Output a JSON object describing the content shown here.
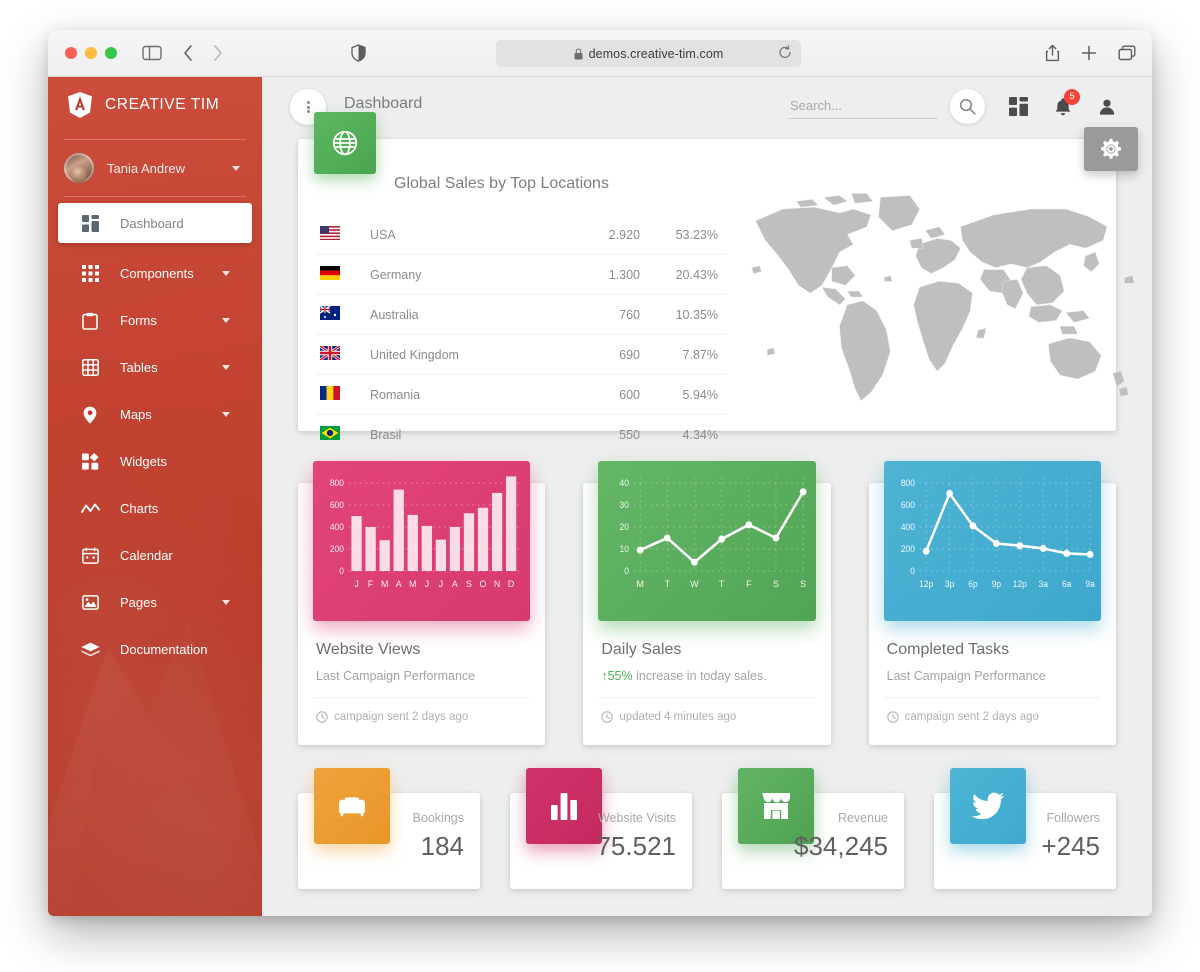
{
  "browser": {
    "url": "demos.creative-tim.com",
    "lock_icon": "lock-icon",
    "reload_icon": "reload-icon",
    "share_icon": "share-icon",
    "new_tab_icon": "plus-icon",
    "tabs_icon": "tabs-overview-icon",
    "shield_icon": "privacy-shield-icon",
    "sidebar_icon": "sidebar-toggle-icon",
    "back_icon": "chevron-left-icon",
    "forward_icon": "chevron-right-icon"
  },
  "sidebar": {
    "brand": "CREATIVE TIM",
    "brand_logo": "angular-shield-logo",
    "user": {
      "name": "Tania Andrew",
      "avatar": "user-avatar",
      "caret": "chevron-down-icon"
    },
    "items": [
      {
        "label": "Dashboard",
        "icon": "dashboard-grid-icon",
        "active": true,
        "expandable": false
      },
      {
        "label": "Components",
        "icon": "apps-grid-icon",
        "active": false,
        "expandable": true
      },
      {
        "label": "Forms",
        "icon": "clipboard-icon",
        "active": false,
        "expandable": true
      },
      {
        "label": "Tables",
        "icon": "table-grid-icon",
        "active": false,
        "expandable": true
      },
      {
        "label": "Maps",
        "icon": "map-pin-icon",
        "active": false,
        "expandable": true
      },
      {
        "label": "Widgets",
        "icon": "widgets-icon",
        "active": false,
        "expandable": false
      },
      {
        "label": "Charts",
        "icon": "line-chart-icon",
        "active": false,
        "expandable": false
      },
      {
        "label": "Calendar",
        "icon": "calendar-icon",
        "active": false,
        "expandable": false
      },
      {
        "label": "Pages",
        "icon": "image-icon",
        "active": false,
        "expandable": true
      },
      {
        "label": "Documentation",
        "icon": "book-stack-icon",
        "active": false,
        "expandable": false
      }
    ]
  },
  "header": {
    "title": "Dashboard",
    "menu_icon": "kebab-menu-icon",
    "search": {
      "placeholder": "Search...",
      "value": "",
      "icon": "search-icon"
    },
    "grid_icon": "dashboard-grid-icon",
    "notifications": {
      "icon": "bell-icon",
      "count": "5"
    },
    "account_icon": "person-icon"
  },
  "global_sales": {
    "title": "Global Sales by Top Locations",
    "badge_icon": "globe-icon",
    "settings_icon": "gear-icon",
    "rows": [
      {
        "flag": "flag-usa",
        "country": "USA",
        "value": "2.920",
        "percent": "53.23%"
      },
      {
        "flag": "flag-germany",
        "country": "Germany",
        "value": "1.300",
        "percent": "20.43%"
      },
      {
        "flag": "flag-australia",
        "country": "Australia",
        "value": "760",
        "percent": "10.35%"
      },
      {
        "flag": "flag-uk",
        "country": "United Kingdom",
        "value": "690",
        "percent": "7.87%"
      },
      {
        "flag": "flag-romania",
        "country": "Romania",
        "value": "600",
        "percent": "5.94%"
      },
      {
        "flag": "flag-brasil",
        "country": "Brasil",
        "value": "550",
        "percent": "4.34%"
      }
    ]
  },
  "chart_data": [
    {
      "type": "bar",
      "card_title": "Website Views",
      "card_subtitle": "Last Campaign Performance",
      "card_footer": "campaign sent 2 days ago",
      "accent": "#d63a6e",
      "categories": [
        "J",
        "F",
        "M",
        "A",
        "M",
        "J",
        "J",
        "A",
        "S",
        "O",
        "N",
        "D"
      ],
      "values": [
        500,
        400,
        280,
        740,
        510,
        410,
        285,
        400,
        525,
        575,
        710,
        860
      ],
      "yticks": [
        0,
        200,
        400,
        600,
        800
      ],
      "ylim": [
        0,
        900
      ],
      "grid": true,
      "title": "",
      "xlabel": "",
      "ylabel": ""
    },
    {
      "type": "line",
      "card_title": "Daily Sales",
      "card_subtitle_prefix": "55%",
      "card_subtitle": " increase in today sales.",
      "card_footer": "updated 4 minutes ago",
      "accent": "#51a455",
      "categories": [
        "M",
        "T",
        "W",
        "T",
        "F",
        "S",
        "S"
      ],
      "values": [
        9.5,
        15,
        4,
        14.5,
        21,
        15,
        36
      ],
      "yticks": [
        0,
        10,
        20,
        30,
        40
      ],
      "ylim": [
        0,
        44
      ],
      "grid": true,
      "title": "",
      "xlabel": "",
      "ylabel": ""
    },
    {
      "type": "line",
      "card_title": "Completed Tasks",
      "card_subtitle": "Last Campaign Performance",
      "card_footer": "campaign sent 2 days ago",
      "accent": "#3da8cc",
      "categories": [
        "12p",
        "3p",
        "6p",
        "9p",
        "12p",
        "3a",
        "6a",
        "9a"
      ],
      "values": [
        180,
        705,
        410,
        250,
        230,
        205,
        160,
        150
      ],
      "yticks": [
        0,
        200,
        400,
        600,
        800
      ],
      "ylim": [
        0,
        900
      ],
      "grid": true,
      "title": "",
      "xlabel": "",
      "ylabel": ""
    }
  ],
  "stats": [
    {
      "label": "Bookings",
      "value": "184",
      "icon": "sofa-icon",
      "color": "orange"
    },
    {
      "label": "Website Visits",
      "value": "75.521",
      "icon": "bar-chart-icon",
      "color": "pink"
    },
    {
      "label": "Revenue",
      "value": "$34,245",
      "icon": "store-icon",
      "color": "green"
    },
    {
      "label": "Followers",
      "value": "+245",
      "icon": "twitter-icon",
      "color": "blue"
    }
  ]
}
